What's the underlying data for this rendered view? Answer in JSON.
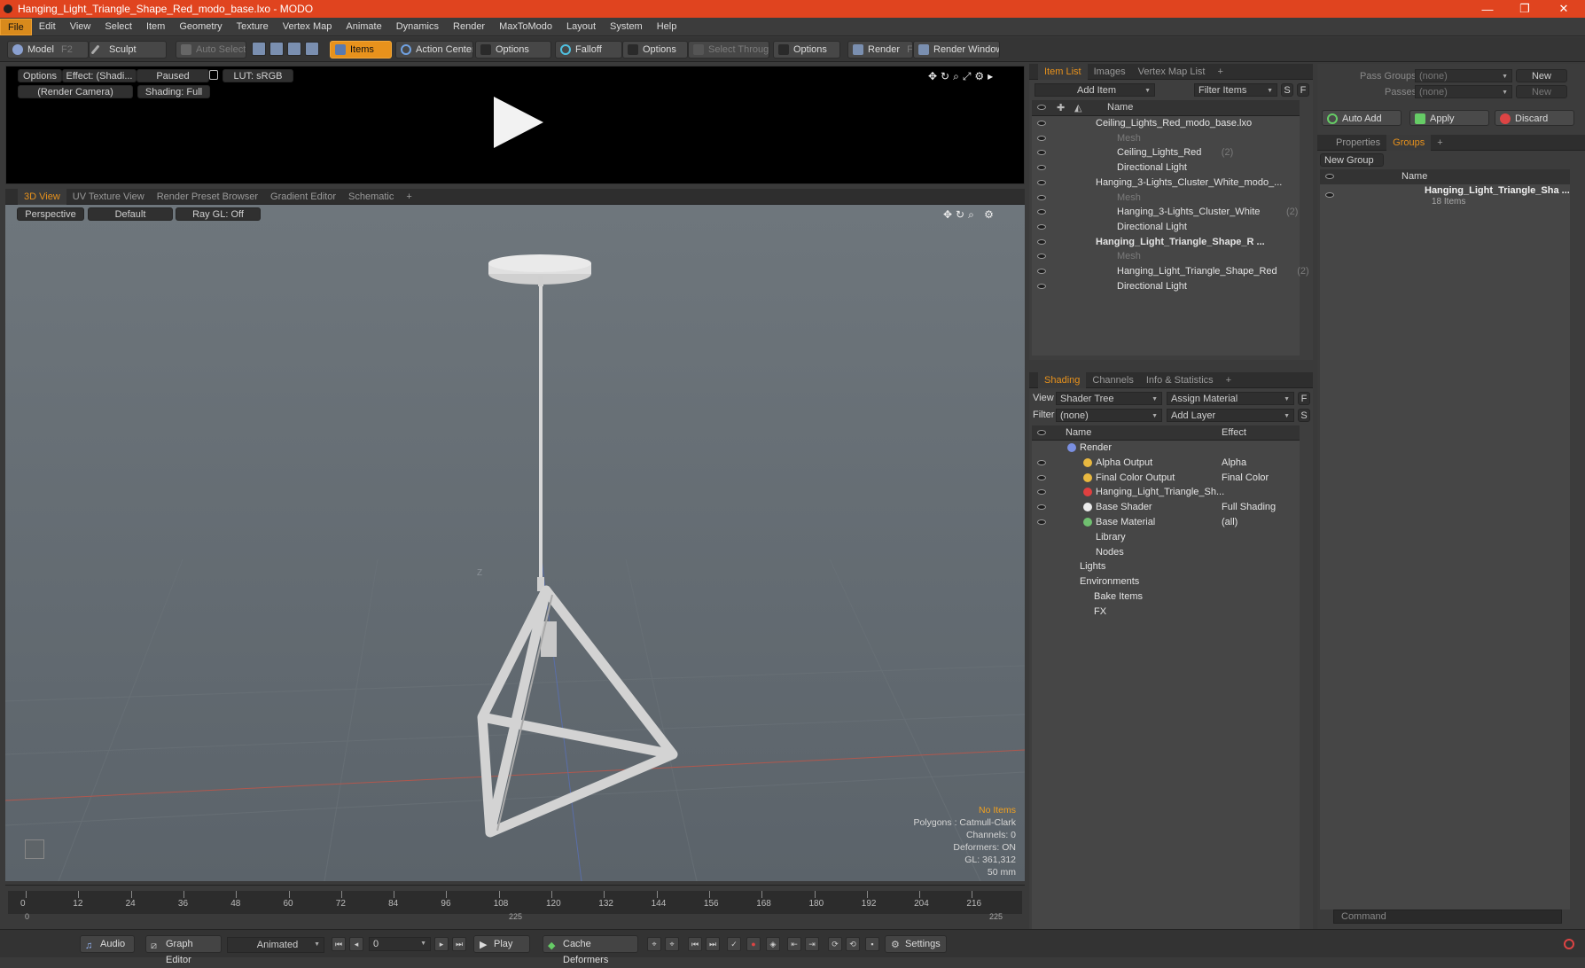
{
  "window": {
    "title": "Hanging_Light_Triangle_Shape_Red_modo_base.lxo - MODO",
    "minimize": "—",
    "maximize": "❐",
    "close": "✕"
  },
  "menu": [
    "File",
    "Edit",
    "View",
    "Select",
    "Item",
    "Geometry",
    "Texture",
    "Vertex Map",
    "Animate",
    "Dynamics",
    "Render",
    "MaxToModo",
    "Layout",
    "System",
    "Help"
  ],
  "toolbar": {
    "model": "Model",
    "model_key": "F2",
    "sculpt": "Sculpt",
    "auto_select": "Auto Select",
    "items": "Items",
    "action_center": "Action Center",
    "options1": "Options",
    "falloff": "Falloff",
    "options2": "Options",
    "select_through": "Select Through",
    "options3": "Options",
    "render": "Render",
    "render_key": "F9",
    "render_window": "Render Window"
  },
  "preview": {
    "options": "Options",
    "effect": "Effect: (Shadi...",
    "paused": "Paused",
    "lut": "LUT: sRGB",
    "camera": "(Render Camera)",
    "shading": "Shading: Full"
  },
  "viewport_tabs": [
    "3D View",
    "UV Texture View",
    "Render Preset Browser",
    "Gradient Editor",
    "Schematic",
    "+"
  ],
  "viewport": {
    "perspective": "Perspective",
    "default": "Default",
    "raygl": "Ray GL: Off",
    "axis_label": "Z"
  },
  "stats": {
    "no_items": "No Items",
    "polygons": "Polygons : Catmull-Clark",
    "channels": "Channels: 0",
    "deformers": "Deformers: ON",
    "gl": "GL: 361,312",
    "lens": "50 mm"
  },
  "timeline": {
    "ticks": [
      "0",
      "12",
      "24",
      "36",
      "48",
      "60",
      "72",
      "84",
      "96",
      "108",
      "120",
      "132",
      "144",
      "156",
      "168",
      "180",
      "192",
      "204",
      "216"
    ],
    "start": "0",
    "mid": "225",
    "end": "225"
  },
  "item_list": {
    "tabs": [
      "Item List",
      "Images",
      "Vertex Map List",
      "+"
    ],
    "add_item": "Add Item",
    "filter_items": "Filter Items",
    "s": "S",
    "f": "F",
    "name_col": "Name",
    "rows": [
      {
        "label": "Ceiling_Lights_Red_modo_base.lxo",
        "count": "",
        "indent": 0,
        "dim": false,
        "bold": false
      },
      {
        "label": "Mesh",
        "count": "",
        "indent": 1,
        "dim": true,
        "bold": false
      },
      {
        "label": "Ceiling_Lights_Red",
        "count": "(2)",
        "indent": 1,
        "dim": false,
        "bold": false
      },
      {
        "label": "Directional Light",
        "count": "",
        "indent": 1,
        "dim": false,
        "bold": false
      },
      {
        "label": "Hanging_3-Lights_Cluster_White_modo_...",
        "count": "",
        "indent": 0,
        "dim": false,
        "bold": false
      },
      {
        "label": "Mesh",
        "count": "",
        "indent": 1,
        "dim": true,
        "bold": false
      },
      {
        "label": "Hanging_3-Lights_Cluster_White",
        "count": "(2)",
        "indent": 1,
        "dim": false,
        "bold": false
      },
      {
        "label": "Directional Light",
        "count": "",
        "indent": 1,
        "dim": false,
        "bold": false
      },
      {
        "label": "Hanging_Light_Triangle_Shape_R ...",
        "count": "",
        "indent": 0,
        "dim": false,
        "bold": true
      },
      {
        "label": "Mesh",
        "count": "",
        "indent": 1,
        "dim": true,
        "bold": false
      },
      {
        "label": "Hanging_Light_Triangle_Shape_Red",
        "count": "(2)",
        "indent": 1,
        "dim": false,
        "bold": false
      },
      {
        "label": "Directional Light",
        "count": "",
        "indent": 1,
        "dim": false,
        "bold": false
      }
    ]
  },
  "shading": {
    "tabs": [
      "Shading",
      "Channels",
      "Info & Statistics",
      "+"
    ],
    "view_label": "View",
    "view_value": "Shader Tree",
    "assign_material": "Assign Material",
    "f": "F",
    "filter_label": "Filter",
    "filter_value": "(none)",
    "add_layer": "Add Layer",
    "s": "S",
    "name_col": "Name",
    "effect_col": "Effect",
    "rows": [
      {
        "label": "Render",
        "effect": ""
      },
      {
        "label": "Alpha Output",
        "effect": "Alpha"
      },
      {
        "label": "Final Color Output",
        "effect": "Final Color"
      },
      {
        "label": "Hanging_Light_Triangle_Sh...",
        "effect": ""
      },
      {
        "label": "Base Shader",
        "effect": "Full Shading"
      },
      {
        "label": "Base Material",
        "effect": "(all)"
      },
      {
        "label": "Library",
        "effect": ""
      },
      {
        "label": "Nodes",
        "effect": ""
      },
      {
        "label": "Lights",
        "effect": ""
      },
      {
        "label": "Environments",
        "effect": ""
      },
      {
        "label": "Bake Items",
        "effect": ""
      },
      {
        "label": "FX",
        "effect": ""
      }
    ]
  },
  "passes": {
    "pass_groups": "Pass Groups",
    "passes": "Passes",
    "none1": "(none)",
    "none2": "(none)",
    "new1": "New",
    "new2": "New",
    "auto_add": "Auto Add",
    "apply": "Apply",
    "discard": "Discard"
  },
  "groups": {
    "tabs": [
      "Properties",
      "Groups",
      "+"
    ],
    "new_group": "New Group",
    "name_col": "Name",
    "group_name": "Hanging_Light_Triangle_Sha ...",
    "group_count": "18 Items"
  },
  "bottom": {
    "audio": "Audio",
    "graph_editor": "Graph Editor",
    "animated": "Animated",
    "frame": "0",
    "play": "Play",
    "cache_deformers": "Cache Deformers",
    "settings": "Settings",
    "command_placeholder": "Command"
  }
}
